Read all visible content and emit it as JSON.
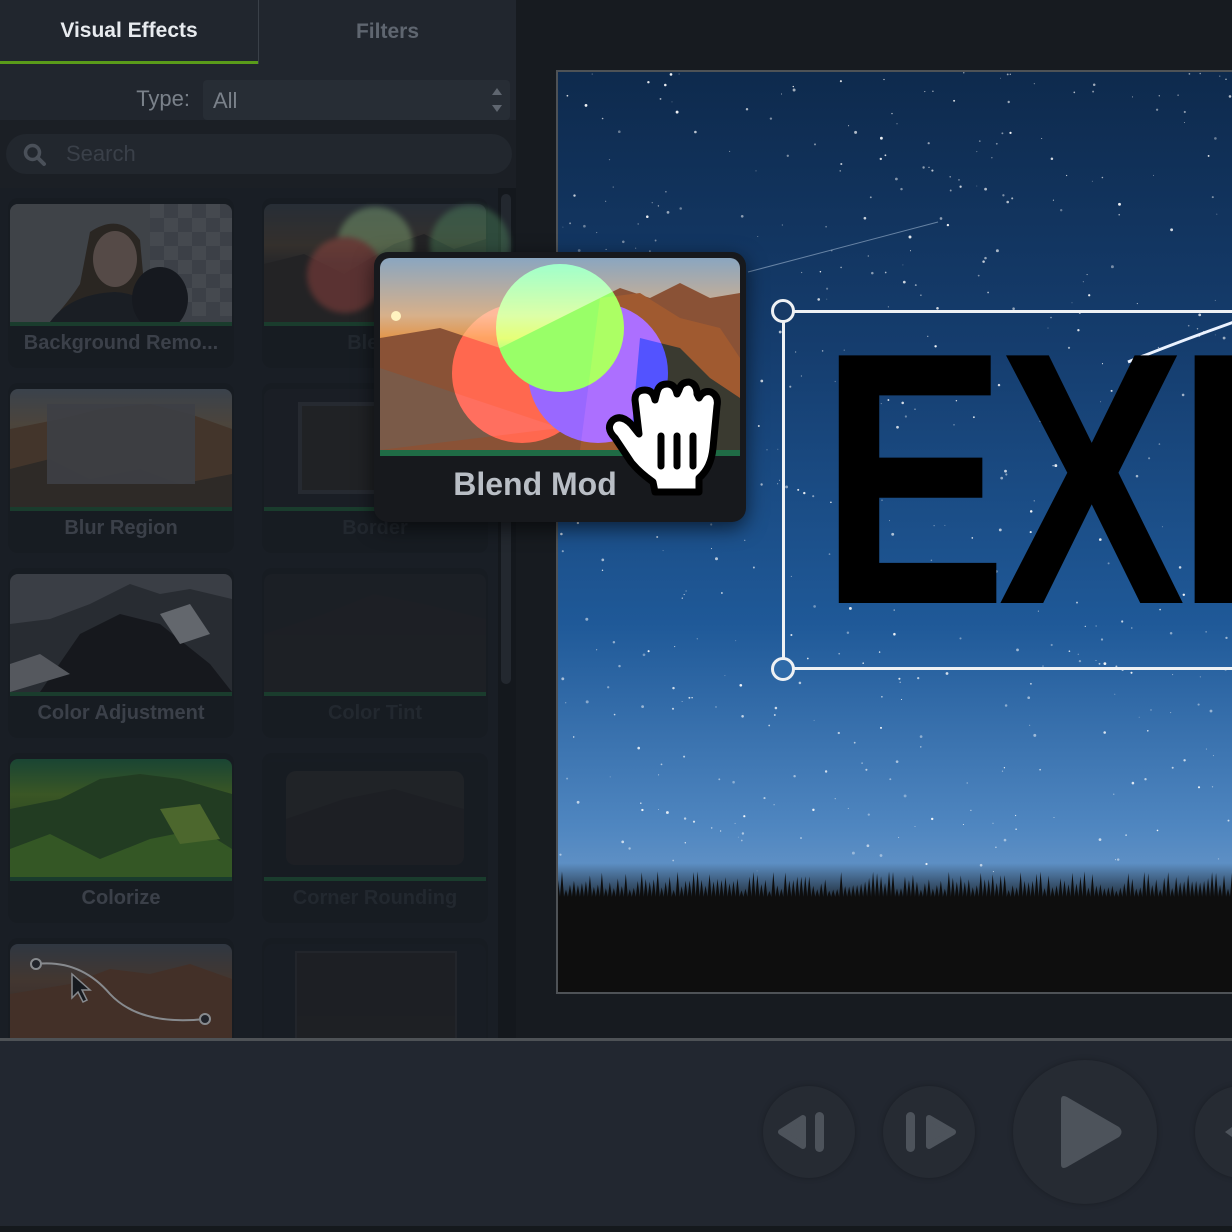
{
  "tabs": [
    {
      "label": "Visual Effects",
      "active": true
    },
    {
      "label": "Filters",
      "active": false
    }
  ],
  "type_filter": {
    "label": "Type:",
    "value": "All"
  },
  "search": {
    "placeholder": "Search",
    "value": ""
  },
  "effects": [
    {
      "label": "Background Remo...",
      "thumb": "woman-checkerboard",
      "dimmed": false
    },
    {
      "label": "Blend",
      "thumb": "mountain-rgb-circles",
      "dimmed": true
    },
    {
      "label": "Blur Region",
      "thumb": "mountain-blur-box",
      "dimmed": false
    },
    {
      "label": "Border",
      "thumb": "mountain-border",
      "dimmed": true
    },
    {
      "label": "Color Adjustment",
      "thumb": "mountain-grayscale",
      "dimmed": false
    },
    {
      "label": "Color Tint",
      "thumb": "mountain-tint",
      "dimmed": true
    },
    {
      "label": "Colorize",
      "thumb": "mountain-green",
      "dimmed": false
    },
    {
      "label": "Corner Rounding",
      "thumb": "mountain-rounded",
      "dimmed": true
    },
    {
      "label": "",
      "thumb": "mountain-curve-path",
      "dimmed": false
    },
    {
      "label": "",
      "thumb": "mountain-frame",
      "dimmed": true
    }
  ],
  "dragged_effect": {
    "label": "Blend Mod",
    "thumb": "mountain-rgb-circles"
  },
  "canvas": {
    "title_text": "EXP"
  },
  "colors": {
    "accent": "#5a9b1a",
    "panel_bg": "#21262e",
    "thumb_bar": "#1f5a3a"
  },
  "playback": {
    "buttons": [
      {
        "name": "step-back",
        "icon": "step-back-icon"
      },
      {
        "name": "step-forward",
        "icon": "step-forward-icon"
      },
      {
        "name": "play",
        "icon": "play-icon"
      },
      {
        "name": "next",
        "icon": "partial-icon"
      }
    ]
  }
}
